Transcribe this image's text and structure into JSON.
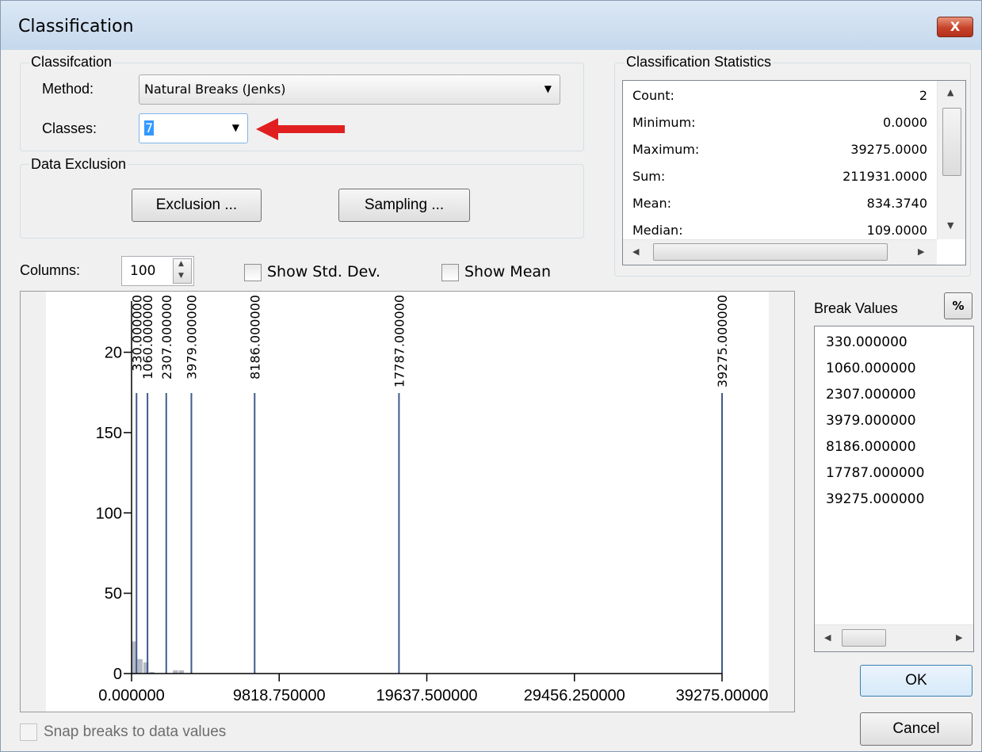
{
  "window": {
    "title": "Classification",
    "close_label": "X"
  },
  "classification_group": {
    "label": "Classifcation",
    "method_label": "Method:",
    "method_value": "Natural Breaks (Jenks)",
    "classes_label": "Classes:",
    "classes_value": "7"
  },
  "exclusion_group": {
    "label": "Data Exclusion",
    "exclusion_button": "Exclusion ...",
    "sampling_button": "Sampling ..."
  },
  "statistics": {
    "label": "Classification Statistics",
    "rows": [
      {
        "key": "Count:",
        "value": "2"
      },
      {
        "key": "Minimum:",
        "value": "0.0000"
      },
      {
        "key": "Maximum:",
        "value": "39275.0000"
      },
      {
        "key": "Sum:",
        "value": "211931.0000"
      },
      {
        "key": "Mean:",
        "value": "834.3740"
      },
      {
        "key": "Median:",
        "value": "109.0000"
      }
    ]
  },
  "histogram_controls": {
    "columns_label": "Columns:",
    "columns_value": "100",
    "show_std_dev": "Show Std. Dev.",
    "show_mean": "Show Mean"
  },
  "breaks": {
    "label": "Break Values",
    "percent_button": "%",
    "values": [
      "330.000000",
      "1060.000000",
      "2307.000000",
      "3979.000000",
      "8186.000000",
      "17787.000000",
      "39275.000000"
    ]
  },
  "buttons": {
    "ok": "OK",
    "cancel": "Cancel"
  },
  "snap_label": "Snap breaks to data values",
  "colors": {
    "break_line": "#3f5b8c",
    "histogram_bar": "#b4b8c4",
    "arrow": "#e02020"
  },
  "chart_data": {
    "type": "bar",
    "title": "",
    "xlabel": "",
    "ylabel": "",
    "xlim": [
      0,
      39275
    ],
    "ylim": [
      0,
      220
    ],
    "x_ticks": [
      "0.000000",
      "9818.750000",
      "19637.500000",
      "29456.250000",
      "39275.00000"
    ],
    "x_tick_values": [
      0,
      9818.75,
      19637.5,
      29456.25,
      39275
    ],
    "y_ticks": [
      "0",
      "50",
      "100",
      "150",
      "20"
    ],
    "y_tick_values": [
      0,
      50,
      100,
      150,
      200
    ],
    "break_labels": [
      "330.000000",
      "1060.000000",
      "2307.000000",
      "3979.000000",
      "8186.000000",
      "17787.000000",
      "39275.000000"
    ],
    "break_values": [
      330,
      1060,
      2307,
      3979,
      8186,
      17787,
      39275
    ],
    "histogram": {
      "x": [
        196,
        589,
        982,
        1375,
        2946,
        3339
      ],
      "values": [
        20,
        9,
        7,
        1,
        2,
        2
      ]
    }
  }
}
